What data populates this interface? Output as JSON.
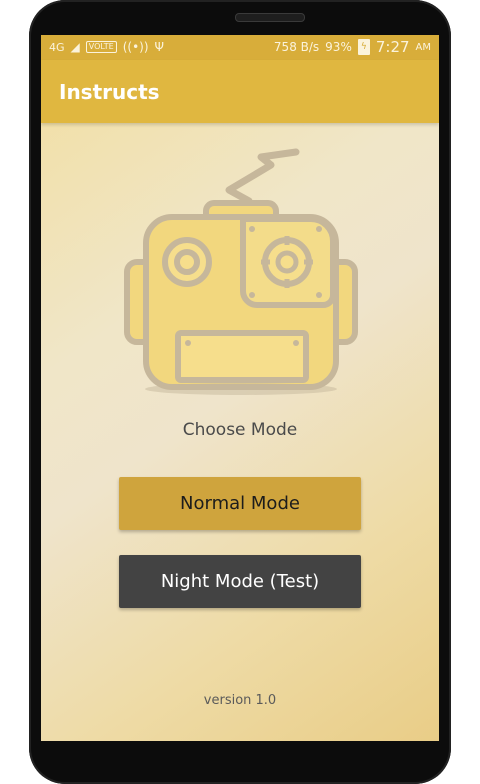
{
  "status_bar": {
    "left_indicators": [
      "4G",
      "VOLTE",
      "((•))",
      "USB"
    ],
    "network_speed": "758 B/s",
    "battery_percent": "93%",
    "time": "7:27",
    "ampm": "AM"
  },
  "app_bar": {
    "title": "Instructs"
  },
  "main": {
    "prompt": "Choose Mode",
    "normal_button": "Normal Mode",
    "night_button": "Night Mode (Test)"
  },
  "footer": {
    "version": "version 1.0"
  },
  "colors": {
    "status_bar": "#d8ad3a",
    "app_bar": "#e0b740",
    "normal_button": "#cfa43d",
    "night_button": "#434343",
    "robot_fill": "#f2d77e",
    "robot_stroke": "#c6b79b"
  }
}
